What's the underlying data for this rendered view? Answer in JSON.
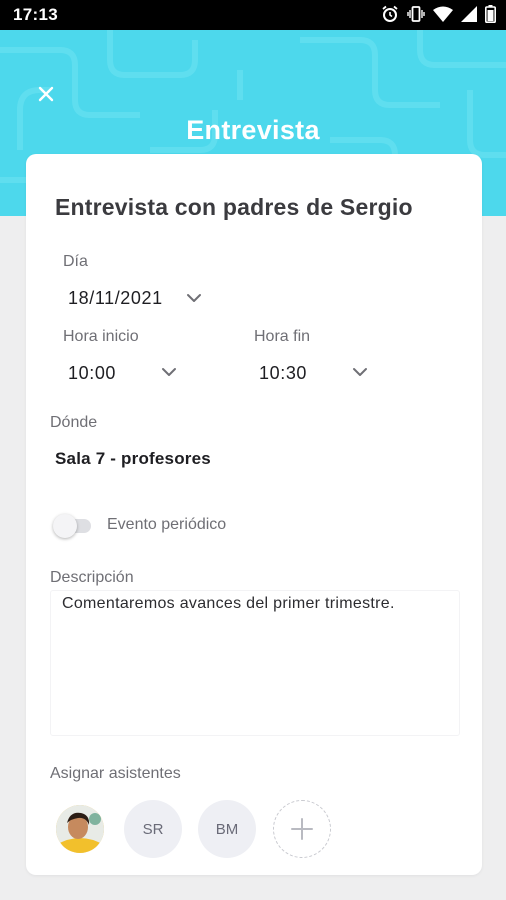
{
  "status_bar": {
    "time": "17:13",
    "icons": [
      "alarm-icon",
      "vibrate-icon",
      "wifi-icon",
      "signal-icon",
      "battery-icon"
    ]
  },
  "header": {
    "title": "Entrevista",
    "close_icon": "close-icon",
    "background_color": "#4dd8ec"
  },
  "event": {
    "title": "Entrevista con padres de Sergio",
    "day": {
      "label": "Día",
      "value": "18/11/2021"
    },
    "start": {
      "label": "Hora inicio",
      "value": "10:00"
    },
    "end": {
      "label": "Hora fin",
      "value": "10:30"
    },
    "location": {
      "label": "Dónde",
      "value": "Sala 7 - profesores"
    },
    "periodic": {
      "label": "Evento periódico",
      "enabled": false
    },
    "description": {
      "label": "Descripción",
      "value": "Comentaremos avances del primer trimestre."
    },
    "attendees": {
      "label": "Asignar asistentes",
      "people": [
        {
          "type": "photo"
        },
        {
          "type": "initials",
          "initials": "SR"
        },
        {
          "type": "initials",
          "initials": "BM"
        }
      ],
      "add_icon": "plus-icon"
    }
  }
}
